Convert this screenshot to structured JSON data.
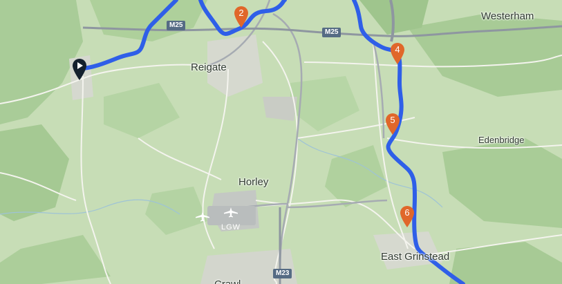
{
  "map": {
    "places": [
      {
        "key": "reigate",
        "label": "Reigate"
      },
      {
        "key": "horley",
        "label": "Horley"
      },
      {
        "key": "westerham",
        "label": "Westerham"
      },
      {
        "key": "edenbridge",
        "label": "Edenbridge"
      },
      {
        "key": "east_grinstead",
        "label": "East Grinstead"
      },
      {
        "key": "crawley_partial",
        "label": "Crawl"
      }
    ],
    "roads": {
      "m25_west": "M25",
      "m25_east": "M25",
      "m23": "M23"
    },
    "airport": {
      "code": "LGW",
      "icon": "airplane-icon"
    },
    "markers": [
      {
        "label": "2"
      },
      {
        "label": "4"
      },
      {
        "label": "5"
      },
      {
        "label": "6"
      }
    ],
    "start_marker": {
      "icon": "play-icon"
    },
    "colors": {
      "route": "#2f5fe8",
      "marker": "#e0672a",
      "start_marker": "#14202e",
      "motorway_shield": "#556b84"
    }
  }
}
